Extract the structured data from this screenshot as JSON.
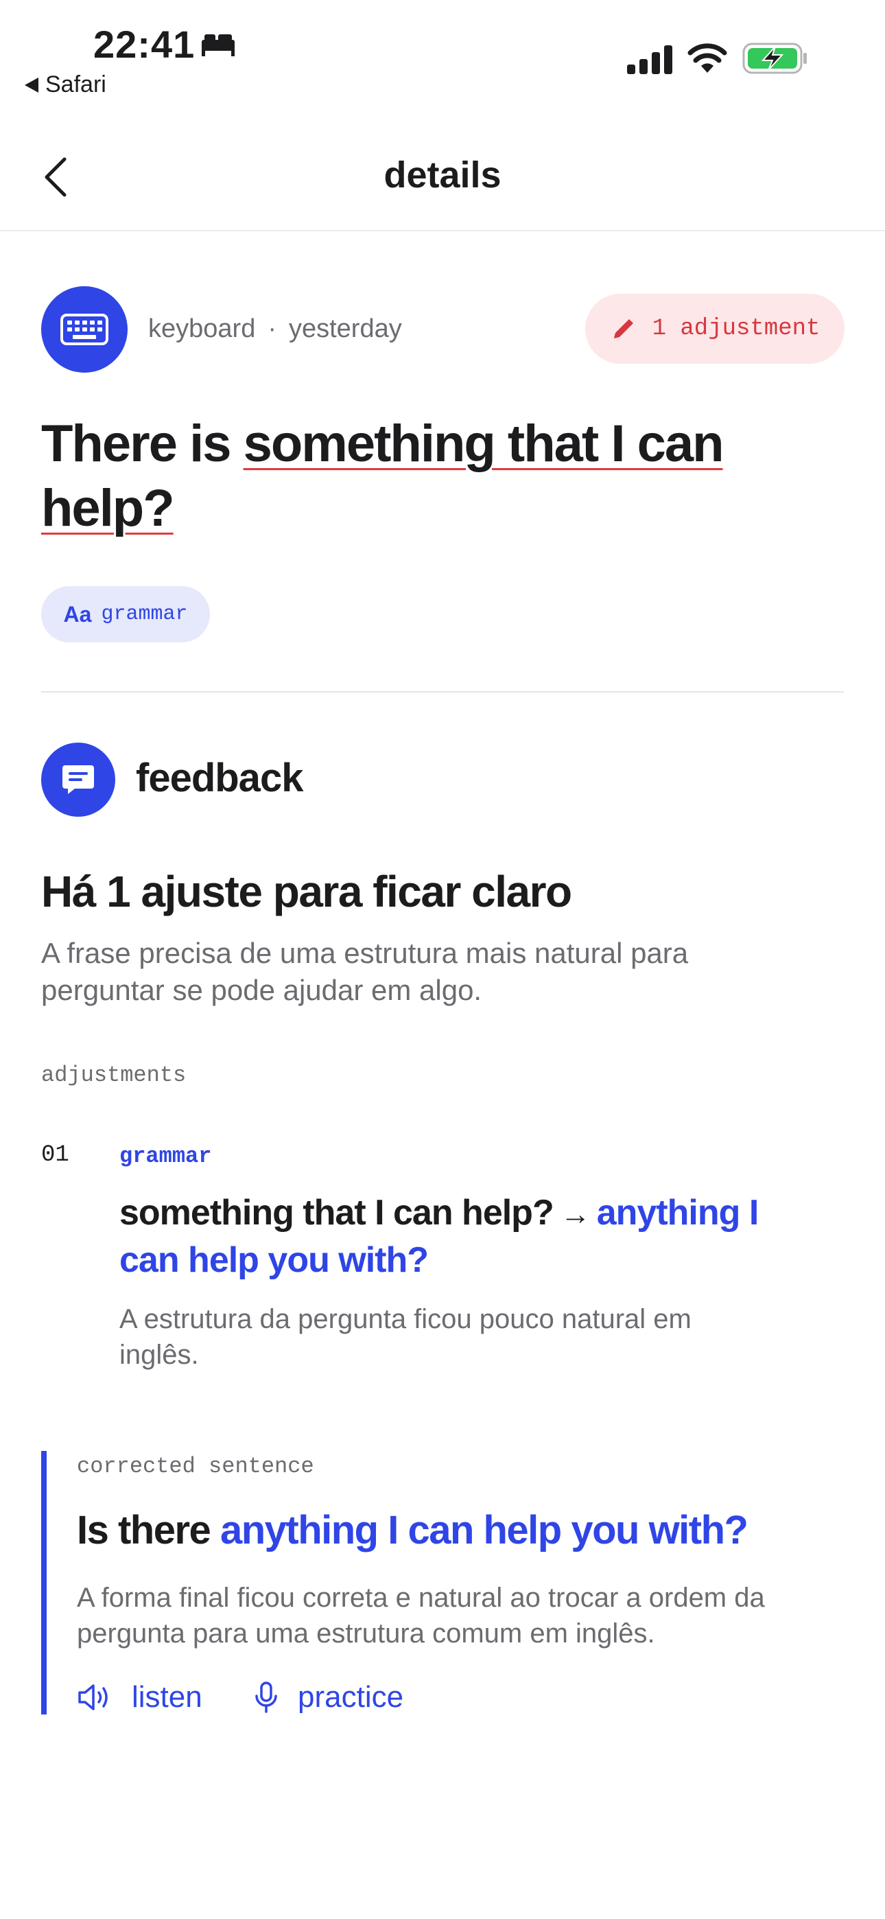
{
  "status_bar": {
    "time": "22:41",
    "back_app": "Safari",
    "icons": [
      "bed-icon",
      "signal-icon",
      "wifi-icon",
      "battery-charging-icon"
    ]
  },
  "nav": {
    "title": "details",
    "back_icon": "chevron-left-icon"
  },
  "entry": {
    "source": "keyboard",
    "separator": "·",
    "when": "yesterday",
    "adjustment_badge": "1 adjustment",
    "sentence_prefix": "There is ",
    "sentence_error": "something that I can help?",
    "chip_aa": "Aa",
    "chip_label": "grammar"
  },
  "feedback": {
    "title": "feedback",
    "headline": "Há 1 ajuste para ficar claro",
    "summary": "A frase precisa de uma estrutura mais natural para perguntar se pode ajudar em algo.",
    "adjustments_label": "adjustments",
    "adjustments": [
      {
        "number": "01",
        "category": "grammar",
        "from": "something that I can help?",
        "arrow": "→",
        "to": "anything I can help you with?",
        "explanation": "A estrutura da pergunta ficou pouco natural em inglês."
      }
    ]
  },
  "corrected": {
    "label": "corrected sentence",
    "prefix": "Is there ",
    "highlight": "anything I can help you with?",
    "explanation": "A forma final ficou correta e natural ao trocar a ordem da pergunta para uma estrutura comum em inglês.",
    "listen_label": "listen",
    "practice_label": "practice"
  },
  "colors": {
    "accent": "#2f45e6",
    "error": "#e03b3b",
    "badge_bg": "#fde7e8",
    "chip_bg": "#e6e9fc",
    "muted_text": "#6b6b70",
    "battery_green": "#34c759"
  }
}
